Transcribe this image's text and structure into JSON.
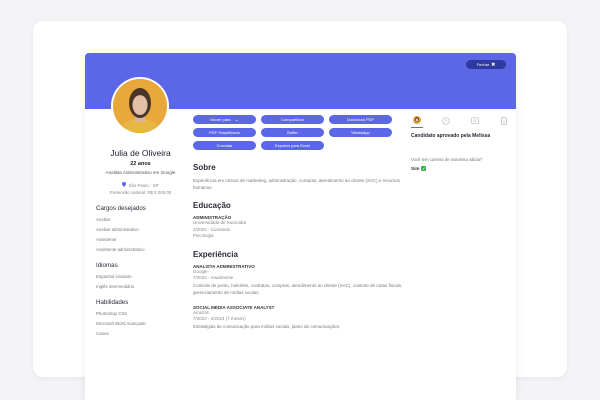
{
  "header": {
    "close_label": "Fechar"
  },
  "profile": {
    "name": "Julia de Oliveira",
    "age": "22 anos",
    "role": "Analista Administrativo em Google",
    "location": "São Paulo - SP",
    "salary": "Pretensão salarial: R$ 5.000,00"
  },
  "sections": {
    "desired_roles": {
      "title": "Cargos desejados",
      "items": [
        "Auxiliar",
        "Auxiliar administrativo",
        "Assistente",
        "Assistente administrativo"
      ]
    },
    "languages": {
      "title": "Idiomas",
      "items": [
        "Espanhol iniciante",
        "Inglês intermediário"
      ]
    },
    "skills": {
      "title": "Habilidades",
      "items": [
        "Photoshop CS6",
        "Microsoft Word Avançado",
        "Canva"
      ]
    }
  },
  "actions": {
    "move": "Mover para",
    "share": "Compartilhar",
    "download_pdf": "Download PDF",
    "pdf_simplified": "PDF Simplificado",
    "buffer": "Buffer",
    "whatsapp": "WhatsApp",
    "invite": "Convidar",
    "export_excel": "Exportar para Excel"
  },
  "about": {
    "title": "Sobre",
    "text": "Experiência em rotinas de marketing, administração, compras, atendimento ao cliente (SAC) e recursos humanos."
  },
  "education": {
    "title": "Educação",
    "course": "ADMINISTRAÇÃO",
    "school": "Universidade de Sorocaba",
    "period": "2/2022 - Cursando",
    "extra": "Psicologia"
  },
  "experience": {
    "title": "Experiência",
    "jobs": [
      {
        "title": "ANALISTA ADMINISTRATIVO",
        "company": "Google",
        "period": "7/2024 - Atualmente",
        "desc": "Controle de ponto, holerites, contratos, compras, atendimento ao cliente (SAC), controle de notas fiscais, gerenciamento de mídias sociais."
      },
      {
        "title": "SOCIAL MEDIA ASSOCIATE ANALYST",
        "company": "Amazon",
        "period": "7/2023 - 2/2024 (7 meses)",
        "desc": "Estratégias de comunicação para mídias sociais, plano de comunicações,"
      }
    ]
  },
  "side": {
    "approved": "Candidato aprovado pela Melissa",
    "question": "Você tem carteira de motorista válida?",
    "answer": "Sim"
  },
  "colors": {
    "primary": "#5b67e6",
    "close": "#2f3a9e",
    "check": "#35b34a"
  },
  "icons": [
    "avatar-tab-icon",
    "clock-icon",
    "chat-icon",
    "document-icon"
  ]
}
